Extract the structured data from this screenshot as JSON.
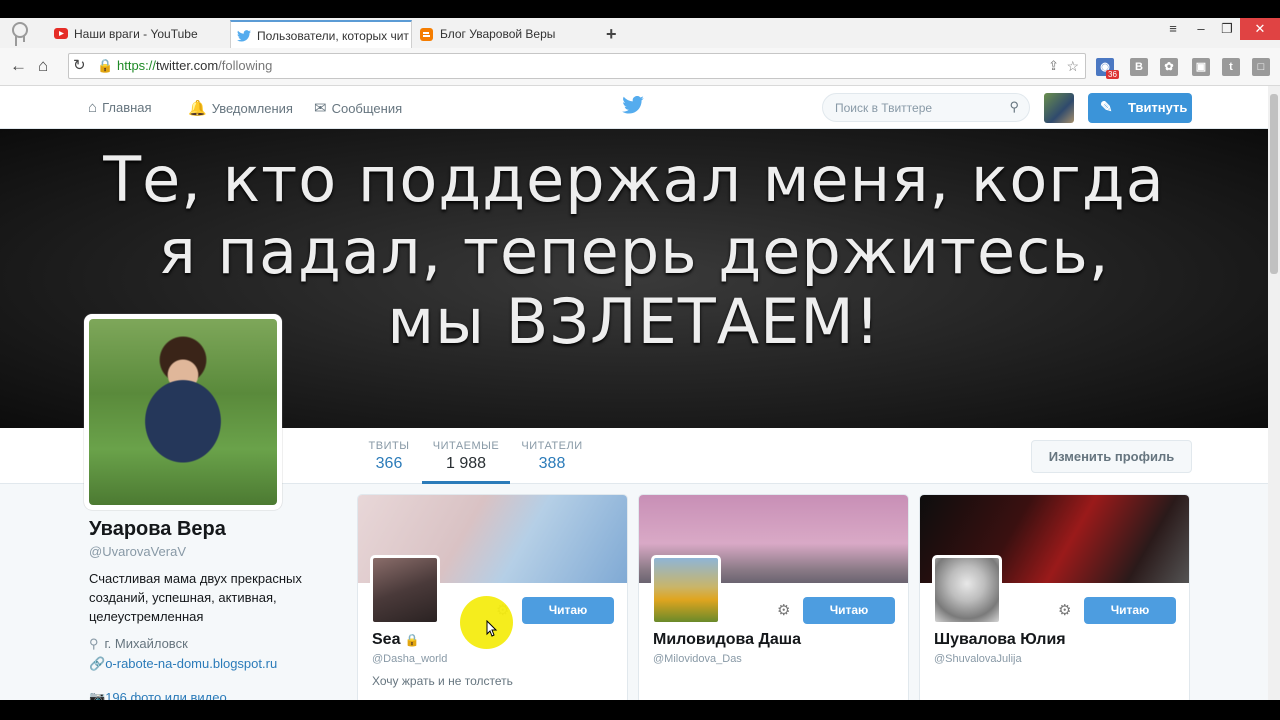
{
  "browser": {
    "tabs": [
      {
        "label": "Наши враги - YouTube",
        "icon": "youtube-icon",
        "active": false
      },
      {
        "label": "Пользователи, которых чит",
        "icon": "twitter-icon",
        "active": true
      },
      {
        "label": "Блог Уваровой Веры",
        "icon": "blogger-icon",
        "active": false
      }
    ],
    "new_tab": "+",
    "url_scheme": "https://",
    "url_host": "twitter.com",
    "url_path": "/following",
    "ext_badge": "36",
    "extensions": [
      "browser-action-icon",
      "vk-icon",
      "odnoklassniki-icon",
      "photo-icon",
      "twitter-ext-icon",
      "chat-icon"
    ]
  },
  "twitter": {
    "nav": {
      "home": "Главная",
      "notifications": "Уведомления",
      "messages": "Сообщения",
      "search_placeholder": "Поиск в Твиттере",
      "tweet_button": "Твитнуть"
    },
    "banner_lines": [
      "Те, кто поддержал меня, когда",
      "я падал, теперь держитесь,",
      "мы ВЗЛЕТАЕМ!"
    ],
    "stats": [
      {
        "label": "ТВИТЫ",
        "value": "366"
      },
      {
        "label": "ЧИТАЕМЫЕ",
        "value": "1 988"
      },
      {
        "label": "ЧИТАТЕЛИ",
        "value": "388"
      }
    ],
    "edit_profile": "Изменить профиль",
    "profile": {
      "name": "Уварова Вера",
      "handle": "@UvarovaVeraV",
      "bio": "Счастливая мама двух прекрасных созданий, успешная, активная, целеустремленная",
      "location": "г. Михайловск",
      "website": "o-rabote-na-domu.blogspot.ru",
      "photos": "196 фото или видео"
    },
    "cards": [
      {
        "name": "Sea",
        "handle": "@Dasha_world",
        "bio": "Хочу жрать и не толстеть",
        "button": "Читаю",
        "locked": true
      },
      {
        "name": "Миловидова Даша",
        "handle": "@Milovidova_Das",
        "bio": "",
        "button": "Читаю",
        "locked": false
      },
      {
        "name": "Шувалова Юлия",
        "handle": "@ShuvalovaJulija",
        "bio": "",
        "button": "Читаю",
        "locked": false
      }
    ],
    "colors": {
      "accent": "#2b7bb9",
      "follow_button": "#4d9de0",
      "tweet_button": "#3b94d9"
    }
  }
}
